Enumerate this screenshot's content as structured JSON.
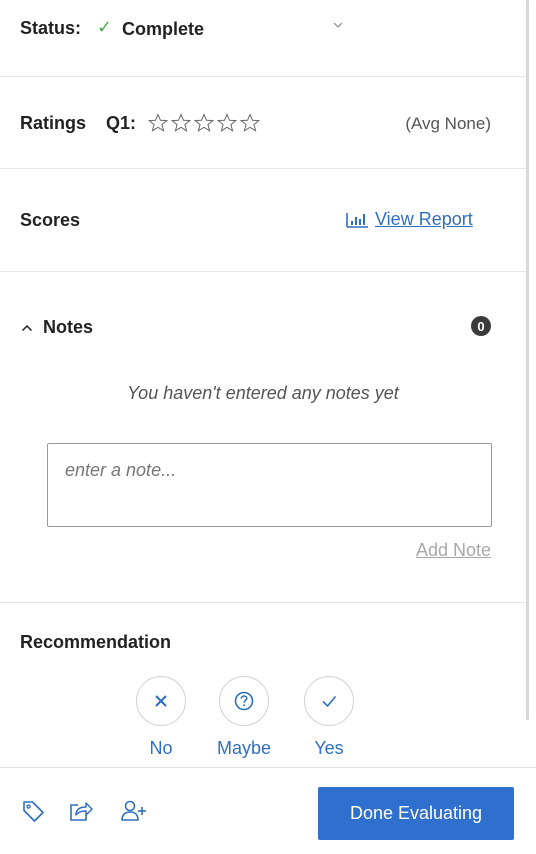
{
  "status": {
    "label": "Status:",
    "value": "Complete",
    "check_icon": "check-icon",
    "dropdown_icon": "chevron-down-icon"
  },
  "ratings": {
    "label": "Ratings",
    "question": "Q1:",
    "stars_total": 5,
    "stars_filled": 0,
    "average": "(Avg None)"
  },
  "scores": {
    "label": "Scores",
    "report_link": "View Report",
    "report_icon": "bar-chart-icon"
  },
  "notes": {
    "title": "Notes",
    "count": "0",
    "empty_message": "You haven't entered any notes yet",
    "input_placeholder": "enter a note...",
    "input_value": "",
    "add_label": "Add Note"
  },
  "recommendation": {
    "title": "Recommendation",
    "options": [
      {
        "label": "No",
        "icon": "x-icon"
      },
      {
        "label": "Maybe",
        "icon": "question-circle-icon"
      },
      {
        "label": "Yes",
        "icon": "check-icon"
      }
    ]
  },
  "footer": {
    "icons": [
      "tag-icon",
      "share-icon",
      "add-user-icon"
    ],
    "done_label": "Done Evaluating"
  },
  "colors": {
    "link": "#2f6fbf",
    "button": "#2f6fce",
    "success": "#4caf50",
    "muted": "#a9a9a9"
  }
}
